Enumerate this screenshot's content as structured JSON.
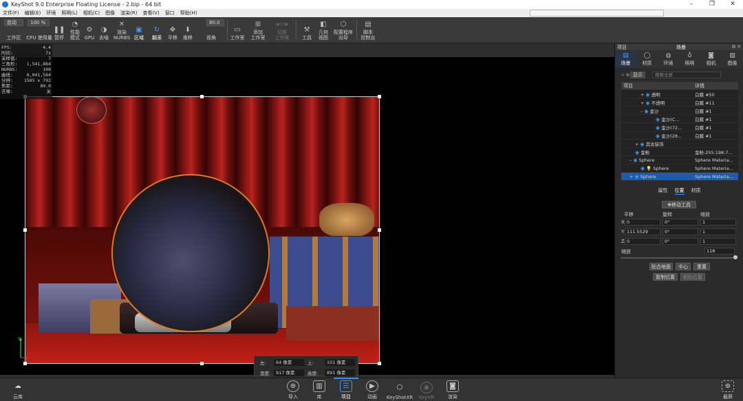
{
  "window": {
    "title": "KeyShot 9.0 Enterprise Floating License  - 2.bip  - 64 bit"
  },
  "menu": [
    "文件(F)",
    "编辑(E)",
    "环境",
    "照明(L)",
    "相机(C)",
    "图像",
    "渲染(R)",
    "查看(V)",
    "窗口",
    "帮助(H)"
  ],
  "toolbar": {
    "mode_value": "启动",
    "zoom_value": "100 %",
    "fov_value": "80.0",
    "items": [
      {
        "label": "工作区"
      },
      {
        "label": "CPU 使用量"
      },
      {
        "label": "暂停"
      },
      {
        "label": "性能\n模式"
      },
      {
        "label": "GPU"
      },
      {
        "label": "去噪"
      },
      {
        "label": "渲染\nNURBS"
      },
      {
        "label": "区域"
      },
      {
        "label": "翻滚"
      },
      {
        "label": "平移"
      },
      {
        "label": "推移"
      },
      {
        "label": "视角"
      },
      {
        "label": "工作室"
      },
      {
        "label": "添加\n工作室"
      },
      {
        "label": "切换\n工作室"
      },
      {
        "label": "工具"
      },
      {
        "label": "几何\n视图"
      },
      {
        "label": "配置程序\n向导"
      },
      {
        "label": "脚本\n控制台"
      }
    ]
  },
  "stats": [
    {
      "k": "FPS:",
      "v": "4.4"
    },
    {
      "k": "时间:",
      "v": "7s"
    },
    {
      "k": "采样值:",
      "v": "7"
    },
    {
      "k": "三角形:",
      "v": "1,541,864"
    },
    {
      "k": "NURBS:",
      "v": "100"
    },
    {
      "k": "曲线:",
      "v": "8,041,584"
    },
    {
      "k": "分辨:",
      "v": "1585 x 792"
    },
    {
      "k": "焦距:",
      "v": "80.0"
    },
    {
      "k": "去噪:",
      "v": "关"
    }
  ],
  "region": {
    "left_label": "左:",
    "left_value": "64 像素",
    "top_label": "上:",
    "top_value": "101 像素",
    "width_label": "宽度:",
    "width_value": "917 像素",
    "height_label": "高度:",
    "height_value": "891 像素"
  },
  "bottom": {
    "cloud": "云库",
    "items": [
      {
        "label": "导入",
        "icon": "import-icon"
      },
      {
        "label": "库",
        "icon": "book-icon"
      },
      {
        "label": "项目",
        "icon": "project-icon"
      },
      {
        "label": "动画",
        "icon": "play-icon"
      },
      {
        "label": "KeyShotXR",
        "icon": "cube-icon"
      },
      {
        "label": "KeyVR",
        "icon": "vr-icon"
      },
      {
        "label": "渲染",
        "icon": "camera-icon"
      }
    ],
    "screenshot": "截屏"
  },
  "panel": {
    "header_left": "项目",
    "header_center": "场景",
    "categories": [
      "场景",
      "材质",
      "环境",
      "照明",
      "相机",
      "图像"
    ],
    "filter_chip": "显示",
    "search_placeholder": "搜索全部",
    "col_item": "项目",
    "col_detail": "详情",
    "tree": [
      {
        "name": "透明",
        "detail": "白膜 #50"
      },
      {
        "name": "不透明",
        "detail": "白膜 #11"
      },
      {
        "name": "金沙",
        "detail": "白膜 #1"
      },
      {
        "name": "金沙(C...",
        "detail": "白膜 #1"
      },
      {
        "name": "金沙(72...",
        "detail": "白膜 #1"
      },
      {
        "name": "金沙(28...",
        "detail": "白膜 #1"
      },
      {
        "name": "其余装饰",
        "detail": ""
      },
      {
        "name": "金粉",
        "detail": "金粉:255:198:7..."
      },
      {
        "name": "Sphere",
        "detail": "Sphere Materia..."
      },
      {
        "name": "Sphere",
        "detail": "Sphere Materia..."
      },
      {
        "name": "Sphere",
        "detail": "Sphere Materia..."
      }
    ],
    "subtabs": [
      "属性",
      "位置",
      "材质"
    ],
    "move_tool": "移动工具",
    "translate": "平移",
    "rotate": "旋转",
    "scale": "缩放",
    "x_label": "X",
    "y_label": "Y",
    "z_label": "Z",
    "tx": "0",
    "ty": "111.5529",
    "tz": "0",
    "rx": "0°",
    "ry": "0°",
    "rz": "0°",
    "sx": "1",
    "sy": "1",
    "sz": "1",
    "uniform_label": "缩放",
    "uniform_value": "118",
    "snap_ground": "贴合地面",
    "center": "中心",
    "reset": "重置",
    "copy_pos": "复制位置",
    "paste_pos": "粘贴位置"
  },
  "colors": {
    "accent": "#2f8fff",
    "selection_row": "#1d5cab",
    "globe_outline": "#e07a1a"
  }
}
